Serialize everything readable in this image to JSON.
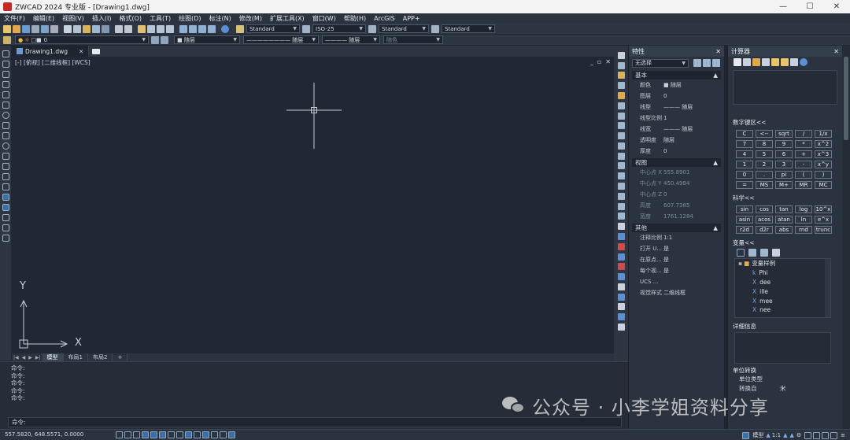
{
  "titlebar": {
    "title": "ZWCAD 2024 专业版 - [Drawing1.dwg]",
    "minimize": "—",
    "maximize": "☐",
    "close": "✕"
  },
  "menubar": [
    "文件(F)",
    "编辑(E)",
    "视图(V)",
    "插入(I)",
    "格式(O)",
    "工具(T)",
    "绘图(D)",
    "标注(N)",
    "修改(M)",
    "扩展工具(X)",
    "窗口(W)",
    "帮助(H)",
    "ArcGIS",
    "APP+"
  ],
  "toolbar1": {
    "text_style": "Standard",
    "dim_style": "ISO-25",
    "table_style": "Standard",
    "multileader_style": "Standard"
  },
  "toolbar2": {
    "layer": "0",
    "color": "随层",
    "linetype": "随层",
    "lineweight": "随层",
    "plotstyle": "随色"
  },
  "document": {
    "tab": "Drawing1.dwg",
    "tab_close": "✕",
    "view_label": "[-] [俯视] [二维线框] [WCS]",
    "view_controls": [
      "_",
      "▫",
      "✕"
    ]
  },
  "ucs": {
    "x_label": "X",
    "y_label": "Y"
  },
  "layout_tabs": {
    "nav": [
      "|◀",
      "◀",
      "▶",
      "▶|"
    ],
    "tabs": [
      "模型",
      "布局1",
      "布局2"
    ],
    "add": "+"
  },
  "command": {
    "history": [
      "命令:",
      "命令:",
      "命令:",
      "命令:",
      "命令:"
    ],
    "prompt": "命令:"
  },
  "status": {
    "coords": "557.5820, 648.5571, 0.0000",
    "scale": "1:1"
  },
  "properties": {
    "title": "特性",
    "close": "✕",
    "selection": "无选择",
    "sections": [
      {
        "name": "基本",
        "rows": [
          {
            "k": "颜色",
            "v": "■ 随层"
          },
          {
            "k": "图层",
            "v": "0"
          },
          {
            "k": "线型",
            "v": "——— 随层"
          },
          {
            "k": "线型比例",
            "v": "1"
          },
          {
            "k": "线宽",
            "v": "——— 随层"
          },
          {
            "k": "透明度",
            "v": "随层"
          },
          {
            "k": "厚度",
            "v": "0"
          }
        ]
      },
      {
        "name": "视图",
        "rows": [
          {
            "k": "中心点 X",
            "v": "555.8901"
          },
          {
            "k": "中心点 Y",
            "v": "450.4984"
          },
          {
            "k": "中心点 Z",
            "v": "0"
          },
          {
            "k": "高度",
            "v": "607.7385"
          },
          {
            "k": "宽度",
            "v": "1761.1284"
          }
        ]
      },
      {
        "name": "其他",
        "rows": [
          {
            "k": "注释比例",
            "v": "1:1"
          },
          {
            "k": "打开 U...",
            "v": "是"
          },
          {
            "k": "在原点...",
            "v": "是"
          },
          {
            "k": "每个视...",
            "v": "是"
          },
          {
            "k": "UCS ...",
            "v": ""
          },
          {
            "k": "视觉样式",
            "v": "二维线框"
          }
        ]
      }
    ]
  },
  "calculator": {
    "title": "计算器",
    "close": "✕",
    "numpad_title": "数字键区<<",
    "numpad": [
      "C",
      "<--",
      "sqrt",
      "/",
      "1/x",
      "7",
      "8",
      "9",
      "*",
      "x^2",
      "4",
      "5",
      "6",
      "+",
      "x^3",
      "1",
      "2",
      "3",
      "-",
      "x^y",
      "0",
      ".",
      "pi",
      "(",
      ")",
      "=",
      "MS",
      "M+",
      "MR",
      "MC"
    ],
    "sci_title": "科学<<",
    "sci": [
      "sin",
      "cos",
      "tan",
      "log",
      "10^x",
      "asin",
      "acos",
      "atan",
      "ln",
      "e^x",
      "r2d",
      "d2r",
      "abs",
      "rnd",
      "trunc"
    ],
    "var_title": "变量<<",
    "var_root": "变量样例",
    "variables": [
      "Phi",
      "dee",
      "ille",
      "mee",
      "nee"
    ],
    "detail_title": "详细信息",
    "unit_title": "单位转换",
    "unit_rows": [
      "单位类型",
      "转换自"
    ],
    "unit_value": "米"
  },
  "watermark": "公众号 · 小李学姐资料分享",
  "colors": {
    "canvas": "#212835",
    "panel": "#2b3340",
    "accent": "#3d6ea5",
    "crosshair": "#c8ccd2"
  }
}
